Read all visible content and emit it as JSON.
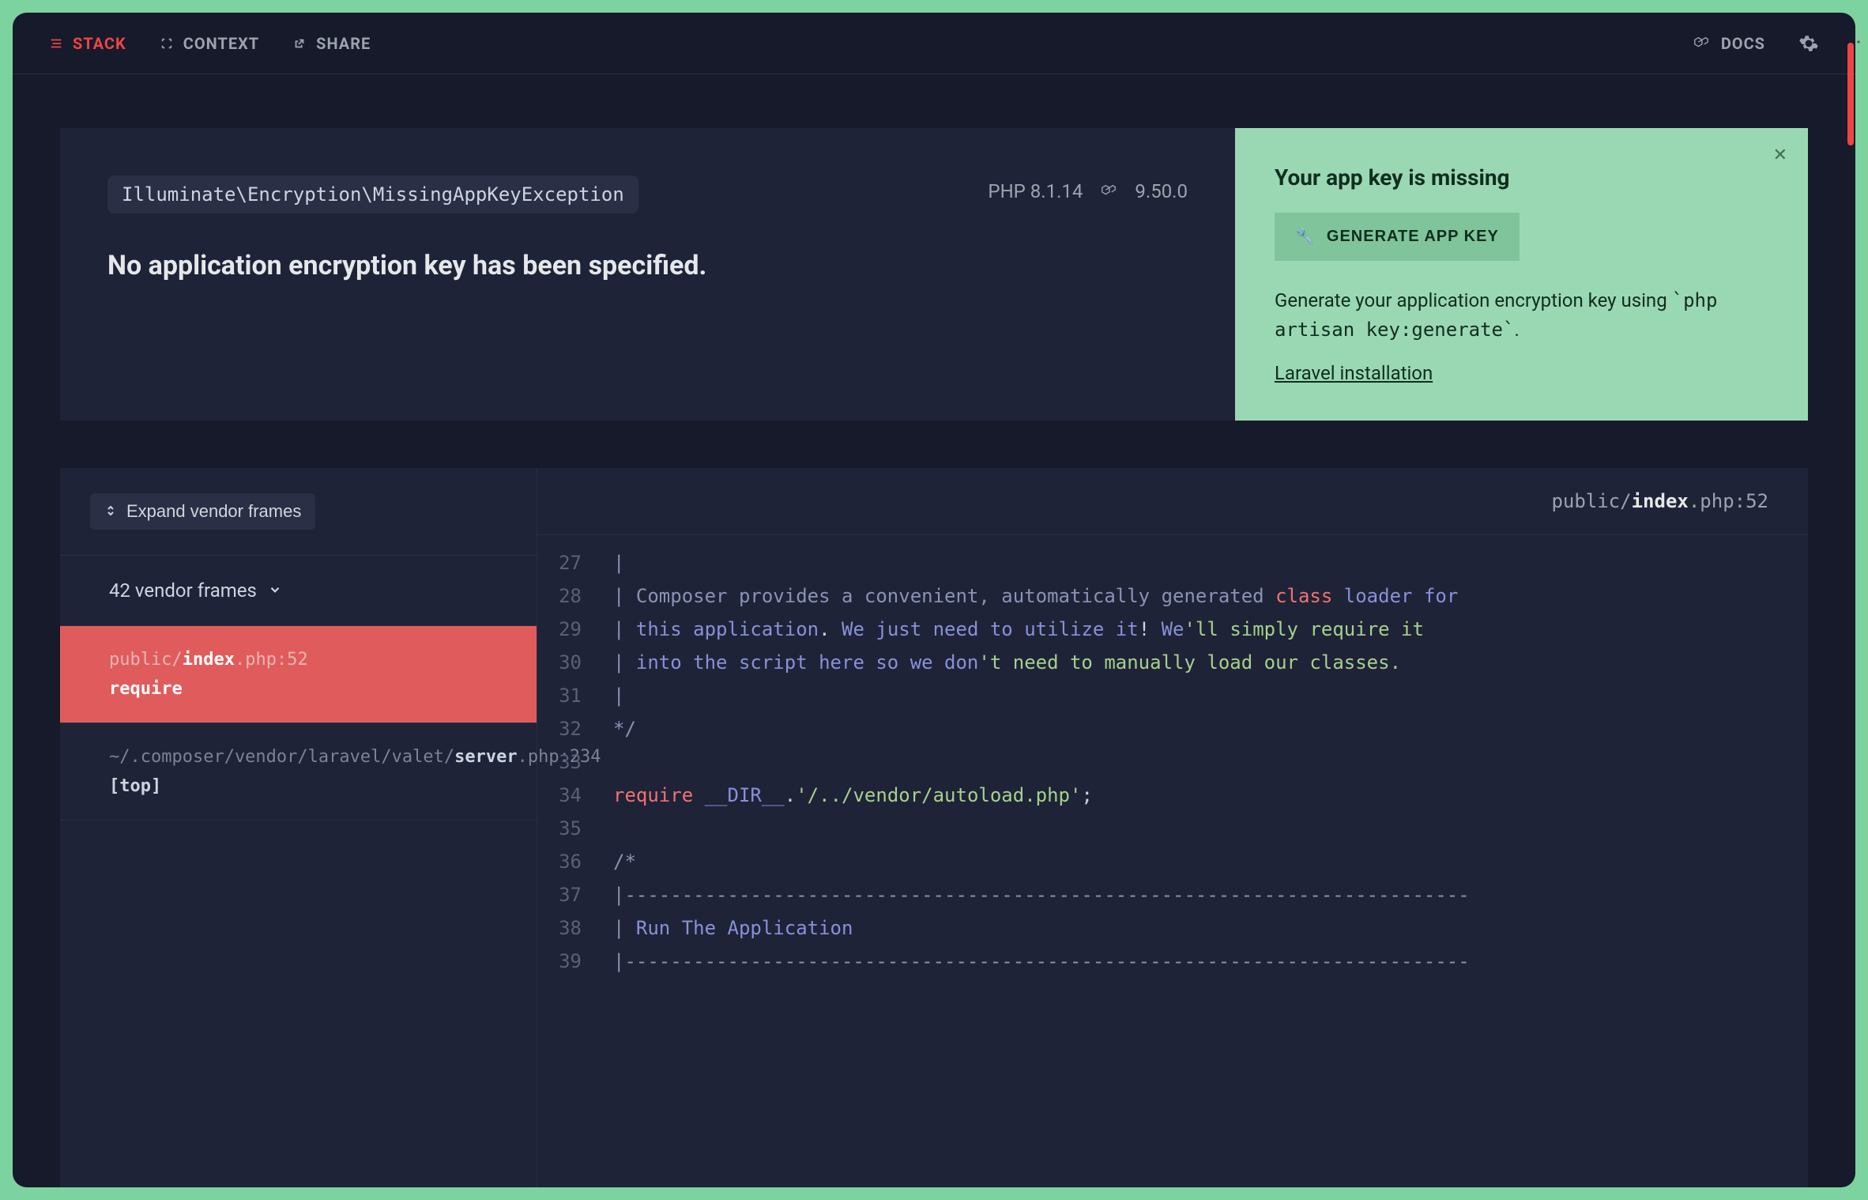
{
  "topbar": {
    "stack": "STACK",
    "context": "CONTEXT",
    "share": "SHARE",
    "docs": "DOCS"
  },
  "exception": {
    "class": "Illuminate\\Encryption\\MissingAppKeyException",
    "php_label": "PHP 8.1.14",
    "laravel_version": "9.50.0",
    "message": "No application encryption key has been specified."
  },
  "solution": {
    "title": "Your app key is missing",
    "button": "GENERATE APP KEY",
    "text_before": "Generate your application encryption key using ",
    "text_code": "`php artisan key:generate`",
    "text_after": ".",
    "link": "Laravel installation"
  },
  "frames": {
    "expand": "Expand vendor frames",
    "vendor_summary": "42 vendor frames",
    "items": [
      {
        "path_dim": "public/",
        "path_bold": "index",
        "path_after": ".php",
        "line": ":52",
        "fn": "require",
        "active": true
      },
      {
        "path_dim": "~/.composer/vendor/laravel/valet/",
        "path_bold": "server",
        "path_after": ".php",
        "line": ":234",
        "fn": "[top]",
        "active": false
      }
    ]
  },
  "code": {
    "header_pre": "public/",
    "header_bold": "index",
    "header_post": ".php",
    "header_line": ":52",
    "lines": [
      {
        "n": 27,
        "html": "<span class='tk-pipe'>|</span>"
      },
      {
        "n": 28,
        "html": "<span class='tk-pipe'>|</span> <span class='tk-c'>Composer provides a convenient, automatically generated</span> <span class='tk-kw'>class</span> <span class='tk-id'>loader</span> <span class='tk-id'>for</span>"
      },
      {
        "n": 29,
        "html": "<span class='tk-pipe'>|</span> <span class='tk-id'>this</span> <span class='tk-id'>application</span><span class='tk-plain'>.</span> <span class='tk-id'>We just need to utilize it</span><span class='tk-plain'>!</span> <span class='tk-id'>We</span><span class='tk-str'>'ll simply require it</span>"
      },
      {
        "n": 30,
        "html": "<span class='tk-pipe'>|</span> <span class='tk-id'>into the script here so we don</span><span class='tk-str'>'t need to manually load our classes.</span>"
      },
      {
        "n": 31,
        "html": "<span class='tk-pipe'>|</span>"
      },
      {
        "n": 32,
        "html": "<span class='tk-c'>*/</span>"
      },
      {
        "n": 33,
        "html": ""
      },
      {
        "n": 34,
        "html": "<span class='tk-kw'>require</span> <span class='tk-id'>__DIR__</span><span class='tk-plain'>.</span><span class='tk-str'>'/../vendor/autoload.php'</span><span class='tk-plain'>;</span>"
      },
      {
        "n": 35,
        "html": ""
      },
      {
        "n": 36,
        "html": "<span class='tk-c'>/*</span>"
      },
      {
        "n": 37,
        "html": "<span class='tk-pipe'>|--------------------------------------------------------------------------</span>"
      },
      {
        "n": 38,
        "html": "<span class='tk-pipe'>|</span> <span class='tk-id'>Run The Application</span>"
      },
      {
        "n": 39,
        "html": "<span class='tk-pipe'>|--------------------------------------------------------------------------</span>"
      }
    ]
  }
}
